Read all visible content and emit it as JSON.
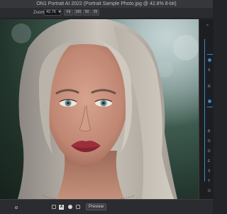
{
  "window": {
    "title": "ON1 Portrait AI 2022 (Portrait Sample Photo.jpg @ 42.8% 8-bit)"
  },
  "toolbar": {
    "zoom_label": "Zoom",
    "zoom_value": "42.76",
    "zoom_presets": [
      "Fit",
      "100",
      "50",
      "25"
    ]
  },
  "bottom_bar": {
    "compare_icon_label": "A",
    "preview_label": "Preview"
  },
  "right_panel": {
    "visible_letters": [
      "O",
      "S",
      "R",
      "B",
      "D",
      "D",
      "E",
      "S",
      "T",
      "O"
    ],
    "accent": "#3d86c6"
  },
  "colors": {
    "app_background": "#232427",
    "title_bar": "#37383b",
    "accent_blue": "#3d86c6"
  }
}
